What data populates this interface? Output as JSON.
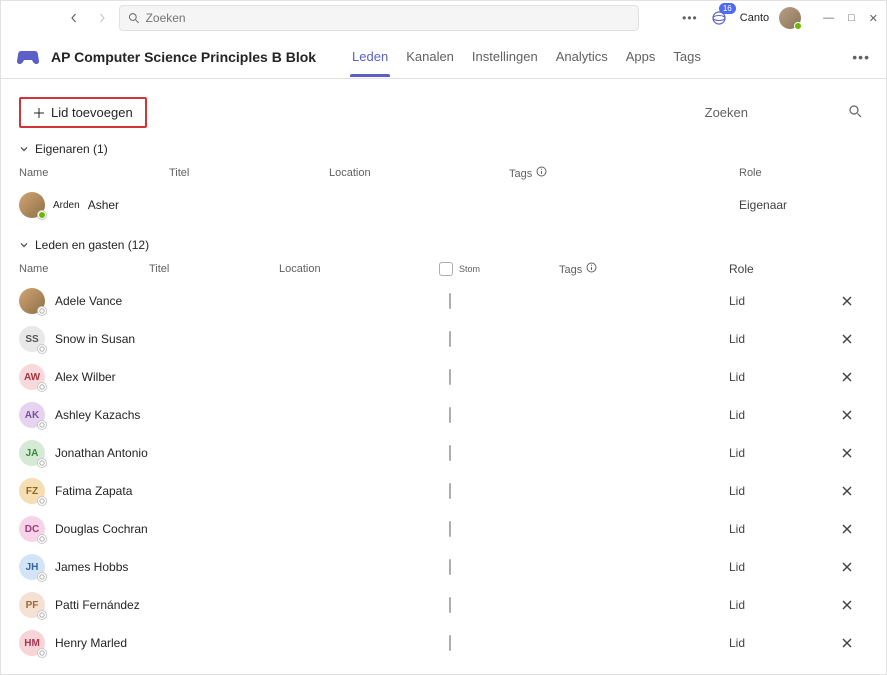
{
  "title_bar": {
    "search_placeholder": "Zoeken",
    "badge_count": "16",
    "canto_label": "Canto"
  },
  "team": {
    "name": "AP Computer Science Principles B Blok"
  },
  "tabs": {
    "members": "Leden",
    "channels": "Kanalen",
    "settings": "Instellingen",
    "analytics": "Analytics",
    "apps": "Apps",
    "tags": "Tags"
  },
  "toolbar": {
    "add_member": "Lid toevoegen",
    "search_label": "Zoeken"
  },
  "owners_group": {
    "label": "Eigenaren (1)",
    "cols": {
      "name": "Name",
      "title": "Titel",
      "location": "Location",
      "tags": "Tags",
      "role": "Role"
    },
    "row": {
      "first": "Arden",
      "last": "Asher",
      "role": "Eigenaar"
    }
  },
  "members_group": {
    "label": "Leden en gasten (12)",
    "cols": {
      "name": "Name",
      "title": "Titel",
      "location": "Location",
      "stom": "Stom",
      "tags": "Tags",
      "role": "Role"
    },
    "role_label": "Lid",
    "rows": [
      {
        "name": "Adele Vance",
        "initials": "",
        "cls": "av-photo"
      },
      {
        "name": "Snow in Susan",
        "initials": "SS",
        "cls": "av-SS"
      },
      {
        "name": "Alex Wilber",
        "initials": "AW",
        "cls": "av-AW"
      },
      {
        "name": "Ashley Kazachs",
        "initials": "AK",
        "cls": "av-AK"
      },
      {
        "name": "Jonathan Antonio",
        "initials": "JA",
        "cls": "av-JA"
      },
      {
        "name": "Fatima Zapata",
        "initials": "FZ",
        "cls": "av-FZ"
      },
      {
        "name": "Douglas Cochran",
        "initials": "DC",
        "cls": "av-DC"
      },
      {
        "name": "James Hobbs",
        "initials": "JH",
        "cls": "av-JH"
      },
      {
        "name": "Patti Fernández",
        "initials": "PF",
        "cls": "av-PF"
      },
      {
        "name": "Henry Marled",
        "initials": "HM",
        "cls": "av-HM"
      }
    ]
  }
}
